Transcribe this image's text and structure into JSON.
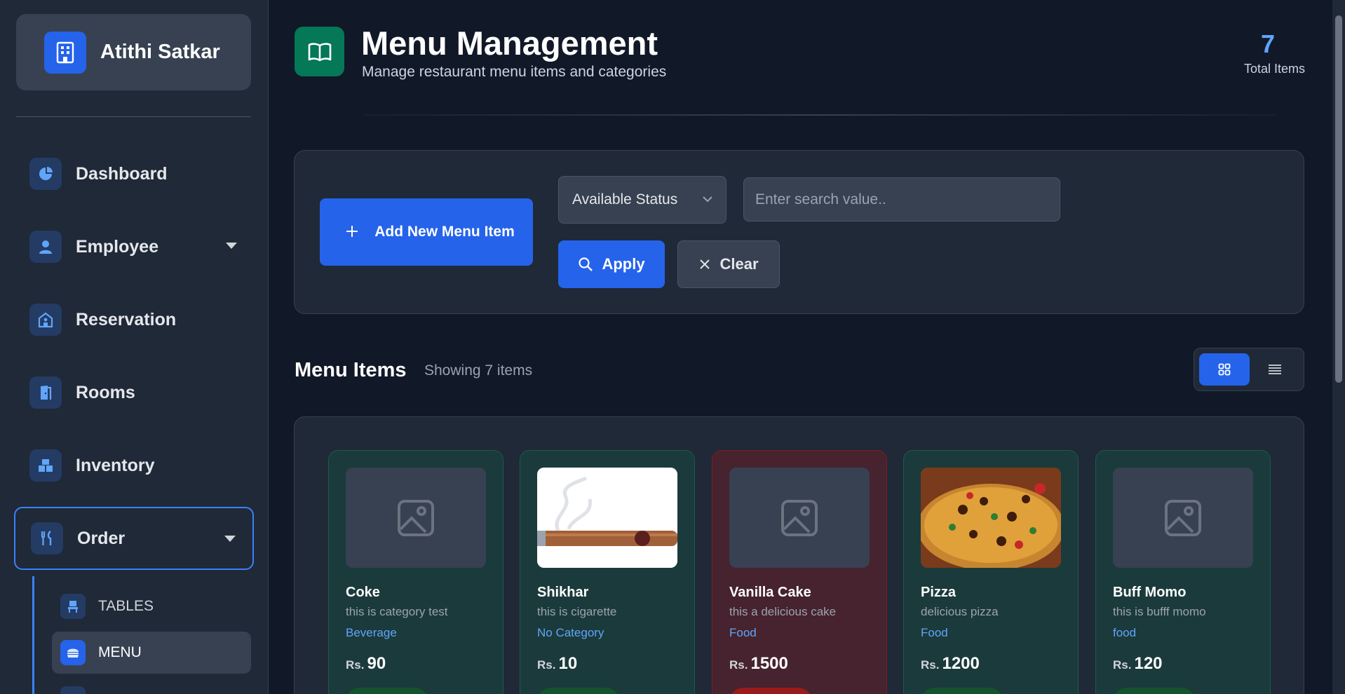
{
  "brand": {
    "name": "Atithi Satkar"
  },
  "sidebar": {
    "items": [
      {
        "label": "Dashboard"
      },
      {
        "label": "Employee"
      },
      {
        "label": "Reservation"
      },
      {
        "label": "Rooms"
      },
      {
        "label": "Inventory"
      },
      {
        "label": "Order"
      }
    ],
    "order_sub": [
      {
        "label": "TABLES"
      },
      {
        "label": "MENU"
      }
    ]
  },
  "header": {
    "title": "Menu Management",
    "subtitle": "Manage restaurant menu items and categories",
    "total_count": "7",
    "total_label": "Total Items"
  },
  "filters": {
    "add_label": "Add New Menu Item",
    "status_value": "Available Status",
    "search_placeholder": "Enter search value..",
    "apply_label": "Apply",
    "clear_label": "Clear"
  },
  "section": {
    "title": "Menu Items",
    "count_text": "Showing 7 items"
  },
  "currency": "Rs.",
  "cards": [
    {
      "name": "Coke",
      "desc": "this is category test",
      "category": "Beverage",
      "price": "90",
      "image": "placeholder-icon",
      "available": true
    },
    {
      "name": "Shikhar",
      "desc": "this is cigarette",
      "category": "No Category",
      "price": "10",
      "image": "cigar-photo",
      "available": true
    },
    {
      "name": "Vanilla Cake",
      "desc": "this a delicious cake",
      "category": "Food",
      "price": "1500",
      "image": "placeholder-icon",
      "available": false
    },
    {
      "name": "Pizza",
      "desc": "delicious pizza",
      "category": "Food",
      "price": "1200",
      "image": "pizza-photo",
      "available": true
    },
    {
      "name": "Buff Momo",
      "desc": "this is bufff momo",
      "category": "food",
      "price": "120",
      "image": "placeholder-icon",
      "available": true
    }
  ],
  "colors": {
    "accent": "#2563eb",
    "available_card": "#1b3a3b",
    "unavailable_card": "#46232e",
    "category_text": "#60a5fa"
  }
}
